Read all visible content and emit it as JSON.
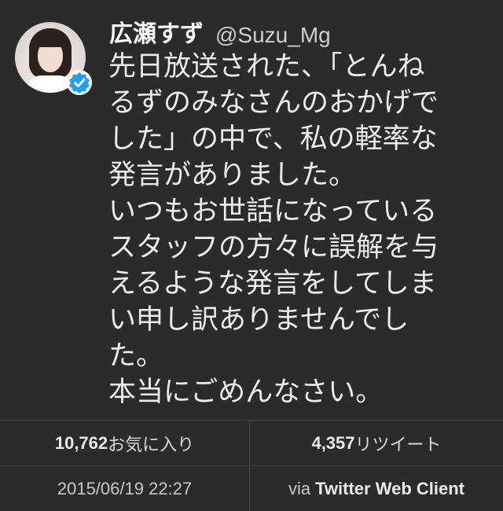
{
  "tweet": {
    "display_name": "広瀬すず",
    "handle": "@Suzu_Mg",
    "lines": [
      "先日放送された、「とんね",
      "るずのみなさんのおかげで",
      "した」の中で、私の軽率な",
      "発言がありました。",
      "いつもお世話になっている",
      "スタッフの方々に誤解を与",
      "えるような発言をしてしま",
      "い申し訳ありませんでし",
      "た。",
      "本当にごめんなさい。"
    ],
    "avatar_icon": "user-photo",
    "verified_icon": "verified-badge-icon",
    "verified_color": "#1da1f2"
  },
  "stats": {
    "favorites_count": "10,762",
    "favorites_label": "お気に入り",
    "retweets_count": "4,357",
    "retweets_label": "リツイート",
    "timestamp": "2015/06/19 22:27",
    "via_prefix": "via",
    "client": "Twitter Web Client"
  }
}
